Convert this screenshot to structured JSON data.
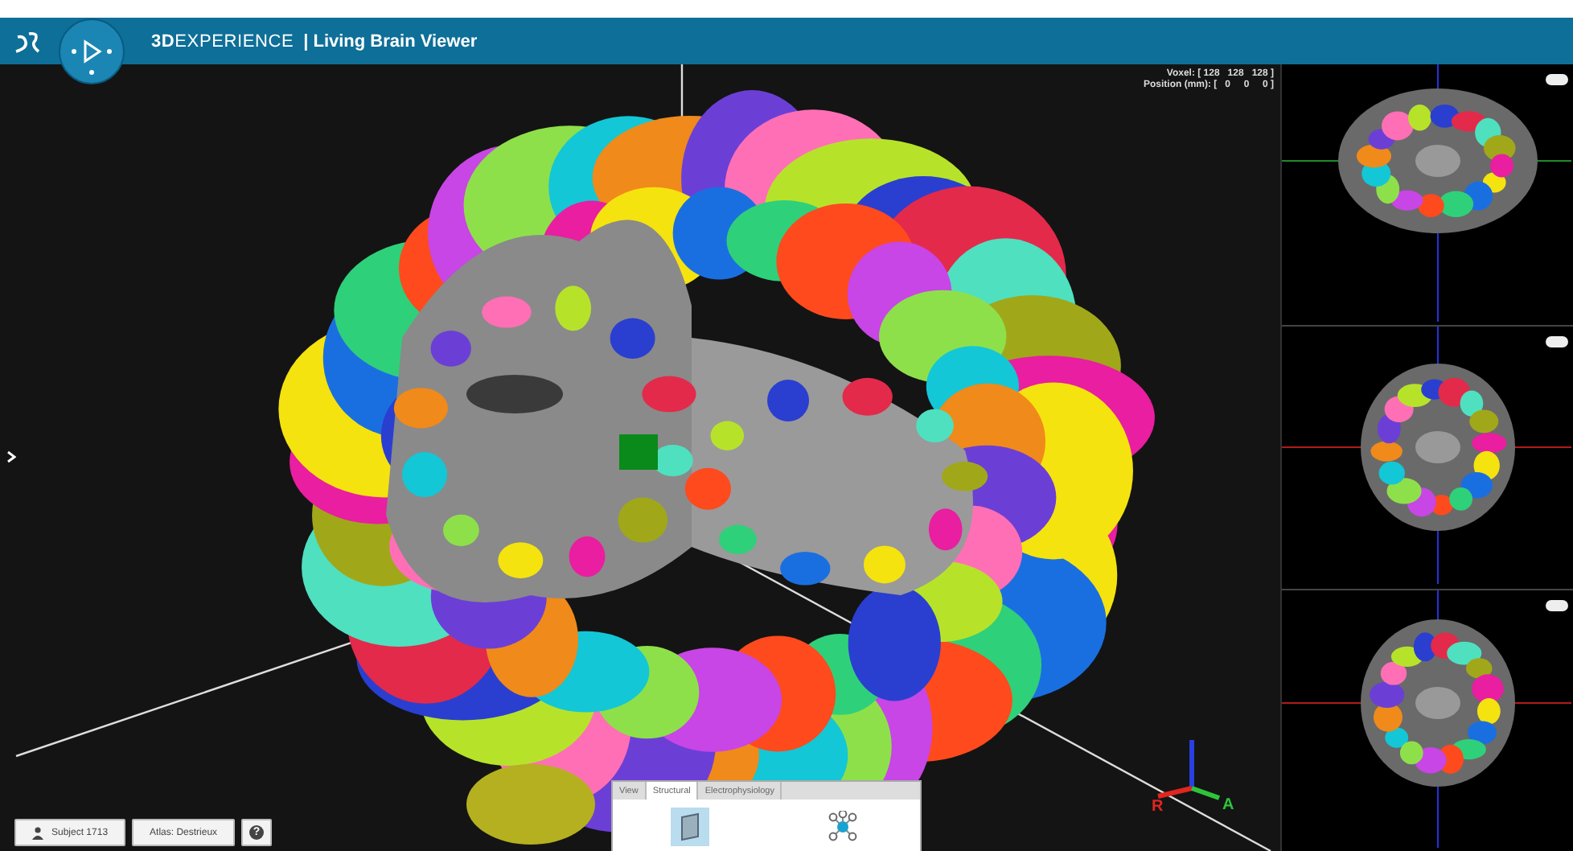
{
  "header": {
    "brand": "**3D**EXPERIENCE",
    "app_title": "| Living Brain Viewer"
  },
  "readouts": [
    "Voxel: [ 128   128   128 ]",
    "Position (mm): [   0     0     0 ]"
  ],
  "axis_labels": [
    {
      "kind": "right",
      "label": "R"
    },
    {
      "kind": "anterior",
      "label": "A"
    }
  ],
  "bottom_buttons": [
    {
      "kind": "subject",
      "label": "Subject 1713"
    },
    {
      "kind": "atlas",
      "label": "Atlas: Destrieux"
    },
    {
      "kind": "help",
      "label": "?"
    }
  ],
  "tool_panel": {
    "tabs": [
      {
        "label": "View",
        "selected": false
      },
      {
        "label": "Structural",
        "selected": true
      },
      {
        "label": "Electrophysiology",
        "selected": false
      }
    ],
    "tools": [
      {
        "kind": "slab",
        "selected": true
      },
      {
        "kind": "network",
        "selected": false
      }
    ]
  },
  "slices": [
    {
      "kind": "sagittal"
    },
    {
      "kind": "coronal"
    },
    {
      "kind": "axial"
    }
  ]
}
